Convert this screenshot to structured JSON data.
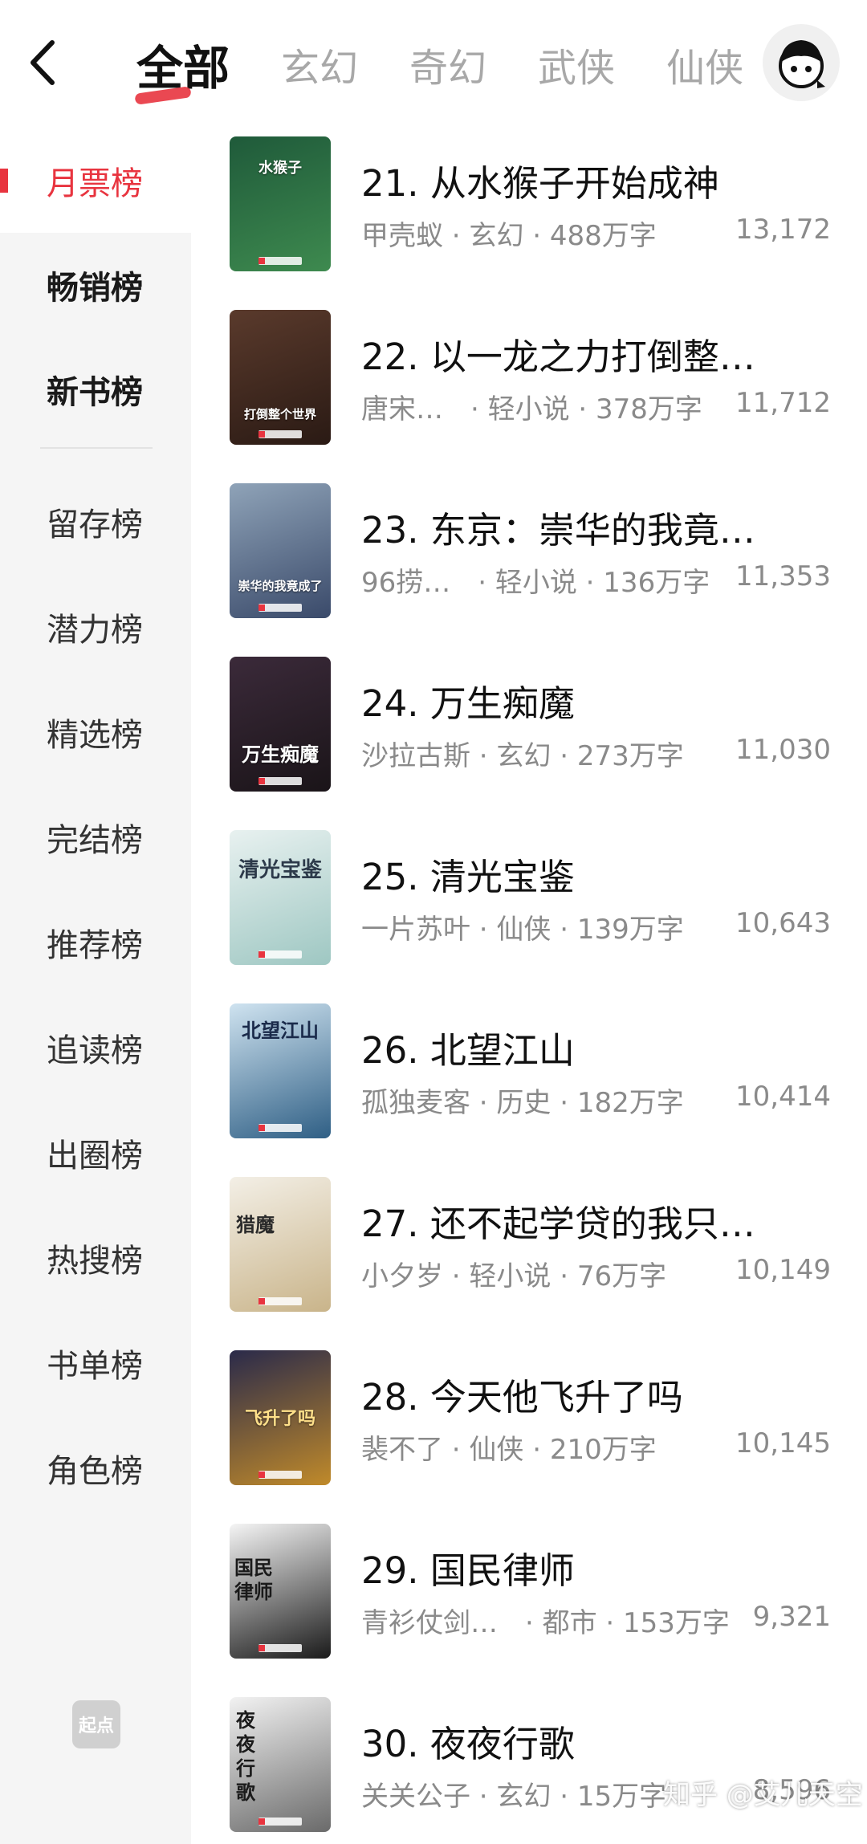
{
  "header": {
    "back_icon": "chevron-left-icon",
    "tabs": [
      {
        "label": "全部",
        "active": true
      },
      {
        "label": "玄幻",
        "active": false
      },
      {
        "label": "奇幻",
        "active": false
      },
      {
        "label": "武侠",
        "active": false
      },
      {
        "label": "仙侠",
        "active": false
      }
    ],
    "avatar_icon": "user-avatar-icon"
  },
  "sidebar": {
    "items": [
      {
        "label": "月票榜",
        "active": true
      },
      {
        "label": "畅销榜",
        "active": false
      },
      {
        "label": "新书榜",
        "active": false
      },
      {
        "label": "留存榜",
        "active": false
      },
      {
        "label": "潜力榜",
        "active": false
      },
      {
        "label": "精选榜",
        "active": false
      },
      {
        "label": "完结榜",
        "active": false
      },
      {
        "label": "推荐榜",
        "active": false
      },
      {
        "label": "追读榜",
        "active": false
      },
      {
        "label": "出圈榜",
        "active": false
      },
      {
        "label": "热搜榜",
        "active": false
      },
      {
        "label": "书单榜",
        "active": false
      },
      {
        "label": "角色榜",
        "active": false
      }
    ],
    "logo_text": "起点"
  },
  "books": [
    {
      "title": "21. 从水猴子开始成神",
      "meta": "甲壳蚁 · 玄幻 · 488万字",
      "count": "13,172",
      "cover_text": "水猴子",
      "cover_colors": [
        "#1f5a3a",
        "#3e8a4f"
      ]
    },
    {
      "title": "22. 以一龙之力打倒整…",
      "meta": "唐宋…　· 轻小说 · 378万字",
      "count": "11,712",
      "cover_text": "打倒整个世界",
      "cover_colors": [
        "#5a3a2c",
        "#2a1a14"
      ]
    },
    {
      "title": "23. 东京：崇华的我竟…",
      "meta": "96捞…　· 轻小说 · 136万字",
      "count": "11,353",
      "cover_text": "崇华的我竟成了",
      "cover_colors": [
        "#8fa3b8",
        "#3a4a6a"
      ]
    },
    {
      "title": "24. 万生痴魔",
      "meta": "沙拉古斯 · 玄幻 · 273万字",
      "count": "11,030",
      "cover_text": "万生痴魔",
      "cover_colors": [
        "#3b2a3a",
        "#1a1418"
      ]
    },
    {
      "title": "25. 清光宝鉴",
      "meta": "一片苏叶 · 仙侠 · 139万字",
      "count": "10,643",
      "cover_text": "清光宝鉴",
      "cover_colors": [
        "#e8f1f0",
        "#9ec7c2"
      ]
    },
    {
      "title": "26. 北望江山",
      "meta": "孤独麦客 · 历史 · 182万字",
      "count": "10,414",
      "cover_text": "北望江山",
      "cover_colors": [
        "#cfe3f0",
        "#2f5f85"
      ]
    },
    {
      "title": "27. 还不起学贷的我只…",
      "meta": "小夕岁 · 轻小说 · 76万字",
      "count": "10,149",
      "cover_text": "猎魔",
      "cover_colors": [
        "#f3efe6",
        "#c9b48a"
      ]
    },
    {
      "title": "28. 今天他飞升了吗",
      "meta": "裴不了 · 仙侠 · 210万字",
      "count": "10,145",
      "cover_text": "飞升了吗",
      "cover_colors": [
        "#2a2a4a",
        "#c08a2a"
      ]
    },
    {
      "title": "29. 国民律师",
      "meta": "青衫仗剑…　· 都市 · 153万字",
      "count": "9,321",
      "cover_text": "国民律师",
      "cover_colors": [
        "#f5f5f5",
        "#1a1a1a"
      ]
    },
    {
      "title": "30. 夜夜行歌",
      "meta": "关关公子 · 玄幻 · 15万字",
      "count": "8,596",
      "cover_text": "夜夜行歌",
      "cover_colors": [
        "#f2f2f2",
        "#6a6a6a"
      ]
    }
  ],
  "watermark": "知乎 @艾儿天空",
  "colors": {
    "accent": "#e8343f",
    "sidebar_bg": "#f5f5f5",
    "meta_text": "#8a8a8a"
  }
}
